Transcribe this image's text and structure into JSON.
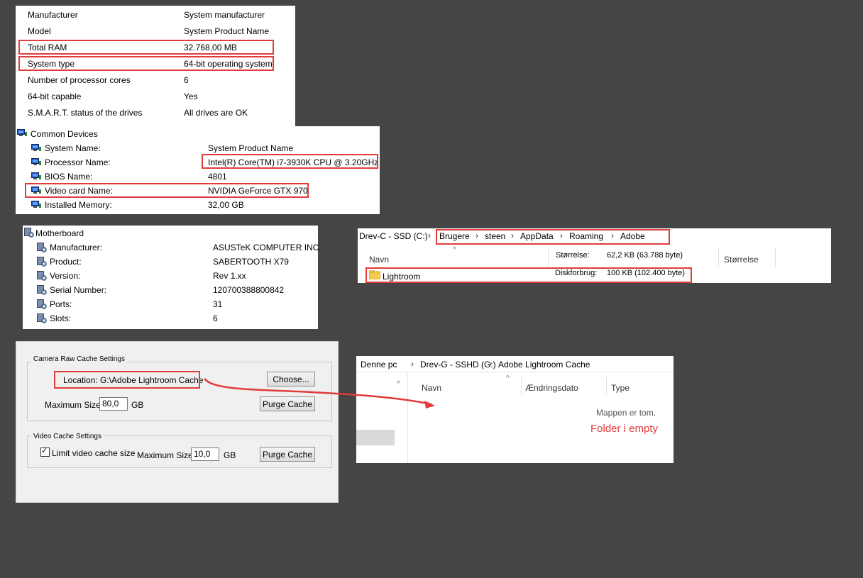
{
  "system_info": {
    "rows": [
      {
        "label": "Manufacturer",
        "value": "System manufacturer"
      },
      {
        "label": "Model",
        "value": "System Product Name"
      },
      {
        "label": "Total RAM",
        "value": "32.768,00 MB"
      },
      {
        "label": "System type",
        "value": "64-bit operating system"
      },
      {
        "label": "Number of processor cores",
        "value": "6"
      },
      {
        "label": "64-bit capable",
        "value": "Yes"
      },
      {
        "label": "S.M.A.R.T. status of the drives",
        "value": "All drives are OK"
      }
    ]
  },
  "common_devices": {
    "title": "Common Devices",
    "rows": [
      {
        "label": "System Name:",
        "value": "System Product Name"
      },
      {
        "label": "Processor Name:",
        "value": "Intel(R) Core(TM) i7-3930K CPU @ 3.20GHz"
      },
      {
        "label": "BIOS Name:",
        "value": "4801"
      },
      {
        "label": "Video card Name:",
        "value": "NVIDIA GeForce GTX 970"
      },
      {
        "label": "Installed Memory:",
        "value": "32,00 GB"
      }
    ]
  },
  "motherboard": {
    "title": "Motherboard",
    "rows": [
      {
        "label": "Manufacturer:",
        "value": "ASUSTeK COMPUTER INC."
      },
      {
        "label": "Product:",
        "value": "SABERTOOTH X79"
      },
      {
        "label": "Version:",
        "value": "Rev 1.xx"
      },
      {
        "label": "Serial Number:",
        "value": "120700388800842"
      },
      {
        "label": "Ports:",
        "value": "31"
      },
      {
        "label": "Slots:",
        "value": "6"
      }
    ]
  },
  "explorer_c": {
    "drive": "Drev-C - SSD (C:)",
    "path": [
      "Brugere",
      "steen",
      "AppData",
      "Roaming",
      "Adobe"
    ],
    "col_name": "Navn",
    "col_size": "Størrelse",
    "size_label": "Størrelse:",
    "size_value": "62,2 KB (63.788 byte)",
    "disk_label": "Diskforbrug:",
    "disk_value": "100 KB (102.400 byte)",
    "folder": "Lightroom"
  },
  "cache_settings": {
    "camera_raw_legend": "Camera Raw Cache Settings",
    "location": "Location:  G:\\Adobe Lightroom Cache",
    "choose_label": "Choose...",
    "max_size_label": "Maximum Size:",
    "max_size_value": "80,0",
    "unit": "GB",
    "purge_label": "Purge Cache",
    "video_legend": "Video Cache Settings",
    "limit_label": "Limit video cache size",
    "video_max_label": "Maximum Size:",
    "video_max_value": "10,0",
    "video_unit": "GB",
    "video_purge_label": "Purge Cache"
  },
  "explorer_g": {
    "path": [
      "Denne pc",
      "Drev-G - SSHD (G:)",
      "Adobe Lightroom Cache"
    ],
    "col_name": "Navn",
    "col_date": "Ændringsdato",
    "col_type": "Type",
    "empty_message": "Mappen er tom.",
    "annotation": "Folder i empty"
  },
  "colors": {
    "highlight": "#e23b3b",
    "background": "#454545"
  }
}
